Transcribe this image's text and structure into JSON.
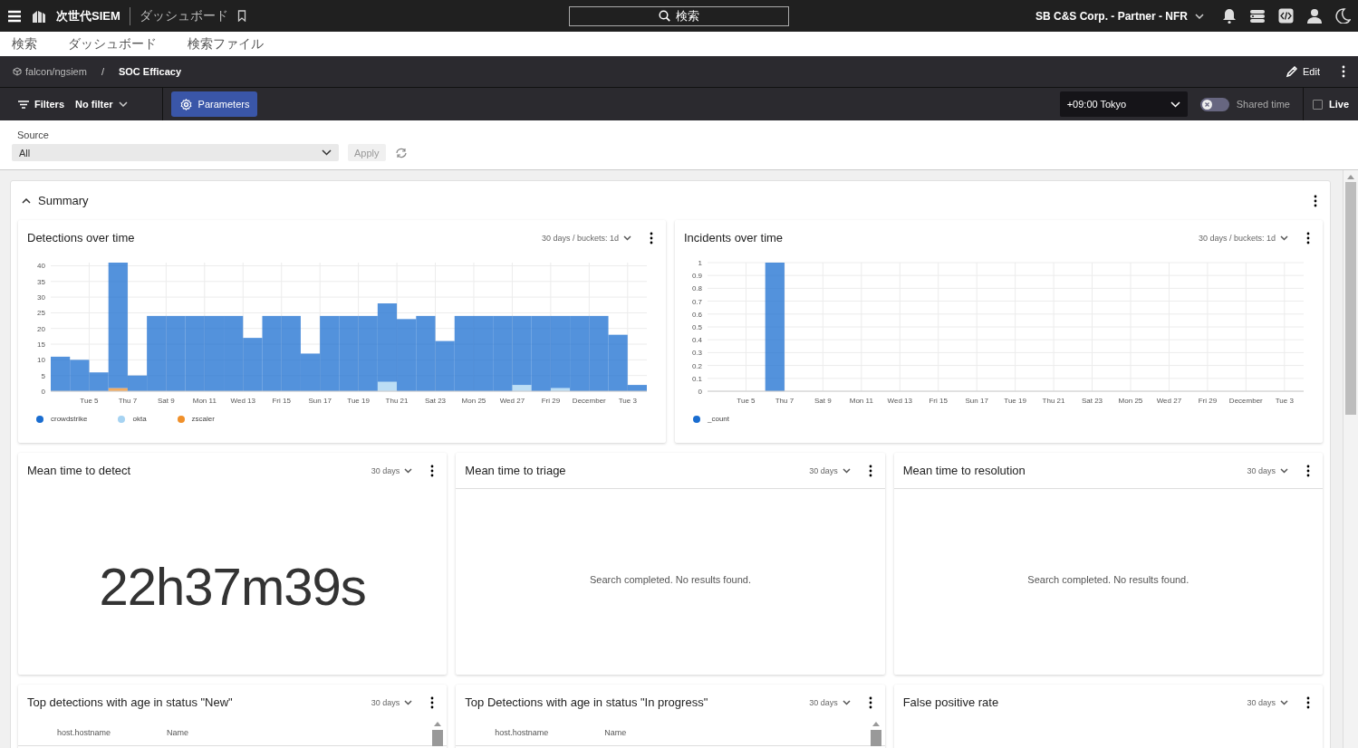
{
  "topbar": {
    "app_name": "次世代SIEM",
    "page_title": "ダッシュボード",
    "search_label": "検索",
    "account": "SB C&S Corp. - Partner - NFR"
  },
  "menu": [
    {
      "label": "検索"
    },
    {
      "label": "ダッシュボード"
    },
    {
      "label": "検索ファイル"
    }
  ],
  "breadcrumb": {
    "repository": "falcon/ngsiem",
    "separator": "/",
    "dashboard": "SOC Efficacy",
    "edit_label": "Edit"
  },
  "toolbar": {
    "filters_label": "Filters",
    "filter_value": "No filter",
    "parameters_label": "Parameters",
    "parameters_selected": true,
    "timezone": "+09:00 Tokyo",
    "shared_time": {
      "label": "Shared time",
      "on": false
    },
    "live": {
      "label": "Live",
      "checked": false
    }
  },
  "parameters": {
    "label": "Source",
    "value": "All",
    "apply_label": "Apply",
    "apply_disabled": true
  },
  "summary": {
    "title": "Summary",
    "expanded": true,
    "widgets": [
      {
        "kind": "chart",
        "title": "Detections over time",
        "range": "30 days / buckets: 1d",
        "chart_data": {
          "type": "bar",
          "stacked": true,
          "grid": true,
          "categories": [
            null,
            null,
            "Tue 5",
            null,
            "Thu 7",
            null,
            "Sat 9",
            null,
            "Mon 11",
            null,
            "Wed 13",
            null,
            "Fri 15",
            null,
            "Sun 17",
            null,
            "Tue 19",
            null,
            "Thu 21",
            null,
            "Sat 23",
            null,
            "Mon 25",
            null,
            "Wed 27",
            null,
            "Fri 29",
            null,
            "December",
            null,
            "Tue 3"
          ],
          "ylim": [
            0,
            41
          ],
          "yticks": [
            0,
            5,
            10,
            15,
            20,
            25,
            30,
            35,
            40
          ],
          "series": [
            {
              "name": "crowdstrike",
              "color": "#1a6dd0",
              "values": [
                11,
                10,
                6,
                40,
                5,
                24,
                24,
                24,
                24,
                24,
                17,
                24,
                24,
                12,
                24,
                24,
                24,
                25,
                23,
                24,
                16,
                24,
                24,
                24,
                22,
                24,
                23,
                24,
                24,
                18,
                2
              ]
            },
            {
              "name": "okta",
              "color": "#a6d3f2",
              "values": [
                0,
                0,
                0,
                0,
                0,
                0,
                0,
                0,
                0,
                0,
                0,
                0,
                0,
                0,
                0,
                0,
                0,
                3,
                0,
                0,
                0,
                0,
                0,
                0,
                2,
                0,
                1,
                0,
                0,
                0,
                0
              ]
            },
            {
              "name": "zscaler",
              "color": "#f0902a",
              "values": [
                0,
                0,
                0,
                1,
                0,
                0,
                0,
                0,
                0,
                0,
                0,
                0,
                0,
                0,
                0,
                0,
                0,
                0,
                0,
                0,
                0,
                0,
                0,
                0,
                0,
                0,
                0,
                0,
                0,
                0,
                0
              ]
            }
          ]
        }
      },
      {
        "kind": "chart",
        "title": "Incidents over time",
        "range": "30 days / buckets: 1d",
        "chart_data": {
          "type": "bar",
          "stacked": true,
          "grid": true,
          "categories": [
            null,
            null,
            "Tue 5",
            null,
            "Thu 7",
            null,
            "Sat 9",
            null,
            "Mon 11",
            null,
            "Wed 13",
            null,
            "Fri 15",
            null,
            "Sun 17",
            null,
            "Tue 19",
            null,
            "Thu 21",
            null,
            "Sat 23",
            null,
            "Mon 25",
            null,
            "Wed 27",
            null,
            "Fri 29",
            null,
            "December",
            null,
            "Tue 3"
          ],
          "ylim": [
            0,
            1
          ],
          "yticks": [
            0,
            0.1,
            0.2,
            0.3,
            0.4,
            0.5,
            0.6,
            0.7,
            0.8,
            0.9,
            1
          ],
          "series": [
            {
              "name": "_count",
              "color": "#1a6dd0",
              "values": [
                0,
                0,
                0,
                1,
                0,
                0,
                0,
                0,
                0,
                0,
                0,
                0,
                0,
                0,
                0,
                0,
                0,
                0,
                0,
                0,
                0,
                0,
                0,
                0,
                0,
                0,
                0,
                0,
                0,
                0,
                0
              ]
            }
          ]
        }
      },
      {
        "kind": "value",
        "title": "Mean time to detect",
        "range": "30 days",
        "value": "22h37m39s"
      },
      {
        "kind": "empty",
        "title": "Mean time to triage",
        "range": "30 days",
        "message": "Search completed. No results found."
      },
      {
        "kind": "empty",
        "title": "Mean time to resolution",
        "range": "30 days",
        "message": "Search completed. No results found."
      },
      {
        "kind": "table",
        "title": "Top detections with age in status \"New\"",
        "range": "30 days",
        "columns": [
          "host.hostname",
          "Name"
        ]
      },
      {
        "kind": "table",
        "title": "Top Detections with age in status \"In progress\"",
        "range": "30 days",
        "columns": [
          "host.hostname",
          "Name"
        ]
      },
      {
        "kind": "blank",
        "title": "False positive rate",
        "range": "30 days"
      }
    ]
  }
}
